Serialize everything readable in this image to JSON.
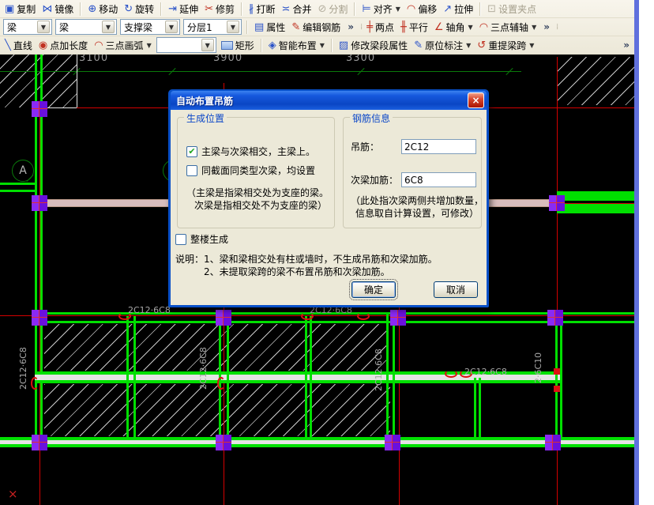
{
  "colors": {
    "beam_green": "#00df00",
    "grid_red": "#d40000",
    "node_purple": "#7a17ef",
    "titlebar_blue": "#0a46c8",
    "toolbar_bg": "#ece8d8"
  },
  "toolbar": {
    "row1": {
      "items": [
        {
          "icon": "▣",
          "label": "复制"
        },
        {
          "icon": "⋈",
          "label": "镜像"
        },
        {
          "icon": "⊕",
          "label": "移动"
        },
        {
          "icon": "↻",
          "label": "旋转"
        },
        {
          "icon": "⇥",
          "label": "延伸"
        },
        {
          "icon": "✂",
          "label": "修剪"
        },
        {
          "icon": "∦",
          "label": "打断"
        },
        {
          "icon": "≍",
          "label": "合并"
        },
        {
          "icon": "⊘",
          "label": "分割"
        },
        {
          "icon": "⊨",
          "label": "对齐"
        },
        {
          "icon": "◠",
          "label": "偏移"
        },
        {
          "icon": "↗",
          "label": "拉伸"
        },
        {
          "icon": "⊡",
          "label": "设置夹点"
        }
      ]
    },
    "row2": {
      "combo1": "梁",
      "combo2": "梁",
      "combo3": "支撑梁",
      "combo4": "分层1",
      "attr_btn": {
        "icon": "▤",
        "label": "属性"
      },
      "edit_rebar_btn": {
        "icon": "✎",
        "label": "编辑钢筋"
      },
      "overflow1": "»",
      "two_point": {
        "icon": "╪",
        "label": "两点"
      },
      "parallel": {
        "icon": "╫",
        "label": "平行"
      },
      "axis_angle": {
        "icon": "∠",
        "label": "轴角"
      },
      "three_point_aux": {
        "icon": "◠",
        "label": "三点辅轴"
      },
      "overflow2": "»"
    },
    "row3": {
      "line": {
        "icon": "╲",
        "label": "直线"
      },
      "point_len": {
        "icon": "◉",
        "label": "点加长度"
      },
      "arc3": {
        "icon": "◠",
        "label": "三点画弧"
      },
      "combo": "",
      "rect": {
        "label": "矩形"
      },
      "smart": {
        "icon": "◈",
        "label": "智能布置"
      },
      "modify": {
        "icon": "▨",
        "label": "修改梁段属性"
      },
      "insitu": {
        "icon": "✎",
        "label": "原位标注"
      },
      "respan": {
        "icon": "↺",
        "label": "重提梁跨"
      },
      "overflow": "»"
    }
  },
  "dialog": {
    "title": "自动布置吊筋",
    "close": "×",
    "gen_group": {
      "legend": "生成位置",
      "cb_main": {
        "mark": "✔",
        "label": "主梁与次梁相交，主梁上。"
      },
      "cb_same": {
        "mark": "",
        "label": "同截面同类型次梁，均设置"
      },
      "note1": "（主梁是指梁相交处为支座的梁。",
      "note2": "次梁是指相交处不为支座的梁）"
    },
    "rebar_group": {
      "legend": "钢筋信息",
      "hanging_label": "吊筋：",
      "hanging_value": "2C12",
      "secondary_label": "次梁加筋：",
      "secondary_value": "6C8",
      "note1": "（此处指次梁两侧共增加数量，",
      "note2": "信息取自计算设置，可修改）"
    },
    "cb_whole": {
      "mark": "",
      "label": "整楼生成"
    },
    "note_line1": "说明：1、梁和梁相交处有柱或墙时，不生成吊筋和次梁加筋。",
    "note_line2": "2、未提取梁跨的梁不布置吊筋和次梁加筋。",
    "ok": "确定",
    "cancel": "取消"
  },
  "canvas": {
    "dims": [
      "3100",
      "3900",
      "3300"
    ],
    "axis_bubble": "A",
    "labels": {
      "h1": "2C12·6C8",
      "h2": "2C12·6C8",
      "h3": "2C12·6C8",
      "v1": "2C12·6C8",
      "v2": "2C12·6C8",
      "v3": "2C12·6C8",
      "v4": "2·6C10"
    },
    "marker_x": "×"
  }
}
